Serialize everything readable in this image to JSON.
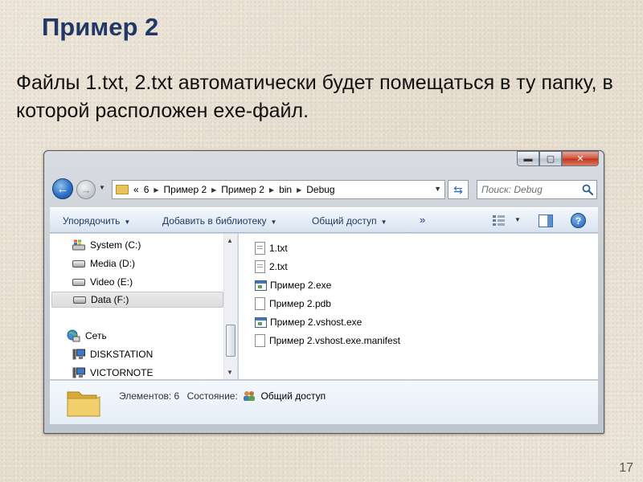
{
  "slide": {
    "title": "Пример 2",
    "text": "Файлы 1.txt, 2.txt автоматически будет помещаться в ту папку, в которой расположен exe-файл.",
    "page_number": "17"
  },
  "window": {
    "controls": {
      "minimize": "▬",
      "maximize": "▢",
      "close": "✕"
    },
    "address": {
      "history_arrow": "▼",
      "overflow": "«",
      "segments": [
        "6",
        "Пример 2",
        "Пример 2",
        "bin",
        "Debug"
      ],
      "separator": "▶",
      "dropdown": "▼"
    },
    "search": {
      "placeholder": "Поиск: Debug"
    },
    "commands": {
      "organize": "Упорядочить",
      "add_to_library": "Добавить в библиотеку",
      "share": "Общий доступ",
      "more": "»",
      "dropdown": "▼"
    },
    "navigation": {
      "drives": [
        "System (C:)",
        "Media (D:)",
        "Video (E:)",
        "Data (F:)"
      ],
      "network": "Сеть",
      "computers": [
        "DISKSTATION",
        "VICTORNOTE"
      ],
      "scroll_up": "▲",
      "scroll_down": "▼"
    },
    "files": [
      {
        "name": "1.txt",
        "type": "txt"
      },
      {
        "name": "2.txt",
        "type": "txt"
      },
      {
        "name": "Пример 2.exe",
        "type": "exe"
      },
      {
        "name": "Пример 2.pdb",
        "type": "blank"
      },
      {
        "name": "Пример 2.vshost.exe",
        "type": "exe"
      },
      {
        "name": "Пример 2.vshost.exe.manifest",
        "type": "blank"
      }
    ],
    "details": {
      "items_label": "Элементов: 6",
      "state_label": "Состояние:",
      "state_value": "Общий доступ"
    }
  },
  "colors": {
    "title": "#1f3864",
    "folder": "#e8c25b",
    "accent_blue": "#2f72c4"
  }
}
